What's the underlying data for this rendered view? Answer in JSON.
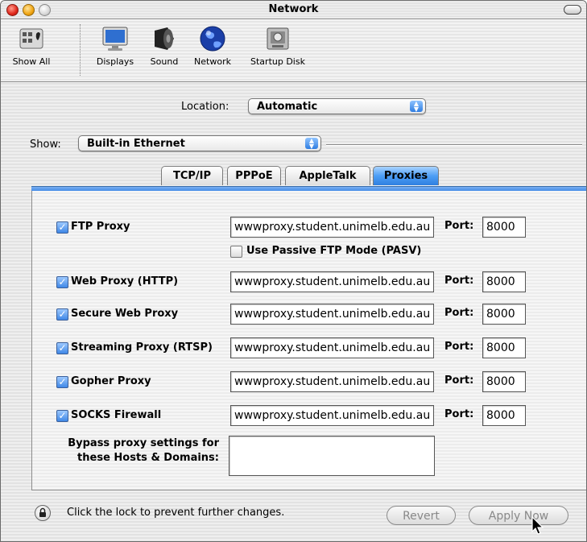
{
  "window": {
    "title": "Network"
  },
  "toolbar": {
    "items": [
      {
        "label": "Show All",
        "icon": "show-all-icon"
      },
      {
        "label": "Displays",
        "icon": "display-icon"
      },
      {
        "label": "Sound",
        "icon": "speaker-icon"
      },
      {
        "label": "Network",
        "icon": "globe-icon"
      },
      {
        "label": "Startup Disk",
        "icon": "disk-icon"
      }
    ]
  },
  "location": {
    "label": "Location:",
    "value": "Automatic"
  },
  "show": {
    "label": "Show:",
    "value": "Built-in Ethernet"
  },
  "tabs": [
    {
      "label": "TCP/IP",
      "active": false
    },
    {
      "label": "PPPoE",
      "active": false
    },
    {
      "label": "AppleTalk",
      "active": false
    },
    {
      "label": "Proxies",
      "active": true
    }
  ],
  "proxies": {
    "port_label": "Port:",
    "rows": [
      {
        "label": "FTP Proxy",
        "checked": true,
        "host": "wwwproxy.student.unimelb.edu.au",
        "port": "8000"
      },
      {
        "label": "Web Proxy (HTTP)",
        "checked": true,
        "host": "wwwproxy.student.unimelb.edu.au",
        "port": "8000"
      },
      {
        "label": "Secure Web Proxy",
        "checked": true,
        "host": "wwwproxy.student.unimelb.edu.au",
        "port": "8000"
      },
      {
        "label": "Streaming Proxy (RTSP)",
        "checked": true,
        "host": "wwwproxy.student.unimelb.edu.au",
        "port": "8000"
      },
      {
        "label": "Gopher Proxy",
        "checked": true,
        "host": "wwwproxy.student.unimelb.edu.au",
        "port": "8000"
      },
      {
        "label": "SOCKS Firewall",
        "checked": true,
        "host": "wwwproxy.student.unimelb.edu.au",
        "port": "8000"
      }
    ],
    "pasv": {
      "label": "Use Passive FTP Mode (PASV)",
      "checked": false
    },
    "bypass": {
      "label_line1": "Bypass proxy settings for",
      "label_line2": "these Hosts & Domains:",
      "value": ""
    }
  },
  "footer": {
    "lock_text": "Click the lock to prevent further changes.",
    "revert_label": "Revert",
    "apply_label": "Apply Now"
  },
  "colors": {
    "accent": "#3f88e6",
    "tab_active": "#4c9ef5"
  }
}
